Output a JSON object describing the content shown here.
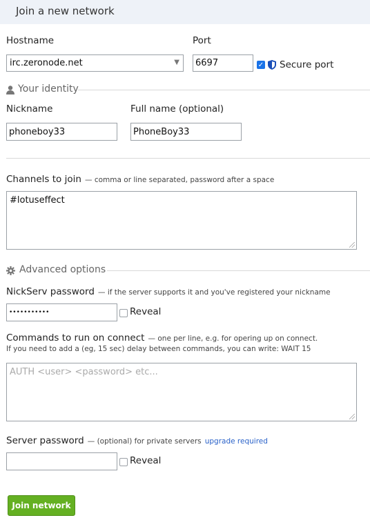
{
  "header": {
    "title": "Join a new network"
  },
  "server": {
    "hostname_label": "Hostname",
    "hostname_value": "irc.zeronode.net",
    "port_label": "Port",
    "port_value": "6697",
    "secure_port_label": "Secure port",
    "secure_port_checked": true
  },
  "identity": {
    "section_title": "Your identity",
    "nickname_label": "Nickname",
    "nickname_value": "phoneboy33",
    "fullname_label": "Full name (optional)",
    "fullname_value": "PhoneBoy33"
  },
  "channels": {
    "label": "Channels to join",
    "hint": "— comma or line separated, password after a space",
    "value": "#lotuseffect"
  },
  "advanced": {
    "section_title": "Advanced options",
    "nickserv_label": "NickServ password",
    "nickserv_hint": "— if the server supports it and you've registered your nickname",
    "nickserv_value": "•••••••••••",
    "nickserv_reveal_label": "Reveal",
    "commands_label": "Commands to run on connect",
    "commands_hint": "— one per line, e.g. for opering up on connect.",
    "commands_hint2": "If you need to add a (eg, 15 sec) delay between commands, you can write: WAIT 15",
    "commands_placeholder": "AUTH <user> <password> etc...",
    "server_password_label": "Server password",
    "server_password_hint": "— (optional) for private servers",
    "server_password_link": "upgrade required",
    "server_password_value": "",
    "server_password_reveal_label": "Reveal"
  },
  "actions": {
    "join_label": "Join network"
  },
  "colors": {
    "accent_blue": "#1a73e8",
    "button_green": "#64b022",
    "header_bg": "#eef2f8",
    "link": "#2a62c9"
  }
}
